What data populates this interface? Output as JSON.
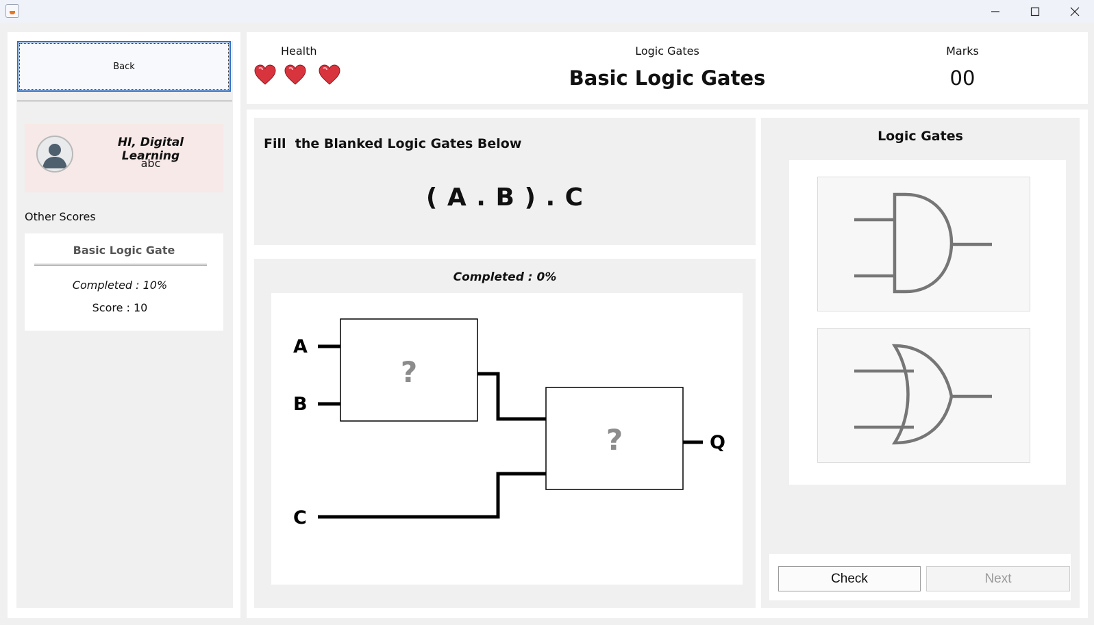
{
  "window": {
    "icons": {
      "app": "java-cup-icon",
      "minimize": "minimize-icon",
      "maximize": "maximize-icon",
      "close": "close-icon"
    }
  },
  "sidebar": {
    "back_label": "Back",
    "profile": {
      "greeting": "HI, Digital Learning",
      "username": "abc"
    },
    "other_scores_label": "Other Scores",
    "score_card": {
      "title": "Basic Logic Gate",
      "completed": "Completed : 10%",
      "score": "Score : 10"
    }
  },
  "header": {
    "health_label": "Health",
    "health_hearts": 3,
    "topic_label": "Logic Gates",
    "topic_title": "Basic Logic Gates",
    "marks_label": "Marks",
    "marks_value": "00"
  },
  "question": {
    "instruction": "Fill  the Blanked Logic Gates Below",
    "expression": "( A . B ) . C"
  },
  "circuit": {
    "completed_text": "Completed : 0%",
    "inputs": [
      "A",
      "B",
      "C"
    ],
    "output": "Q",
    "gate_placeholder": "?"
  },
  "gates_panel": {
    "title": "Logic Gates",
    "gates": [
      "and-gate-icon",
      "or-gate-icon"
    ]
  },
  "actions": {
    "check_label": "Check",
    "next_label": "Next"
  },
  "colors": {
    "accent_border": "#2f6fc6",
    "heart": "#d8343e",
    "profile_bg": "#f6e9e7"
  }
}
